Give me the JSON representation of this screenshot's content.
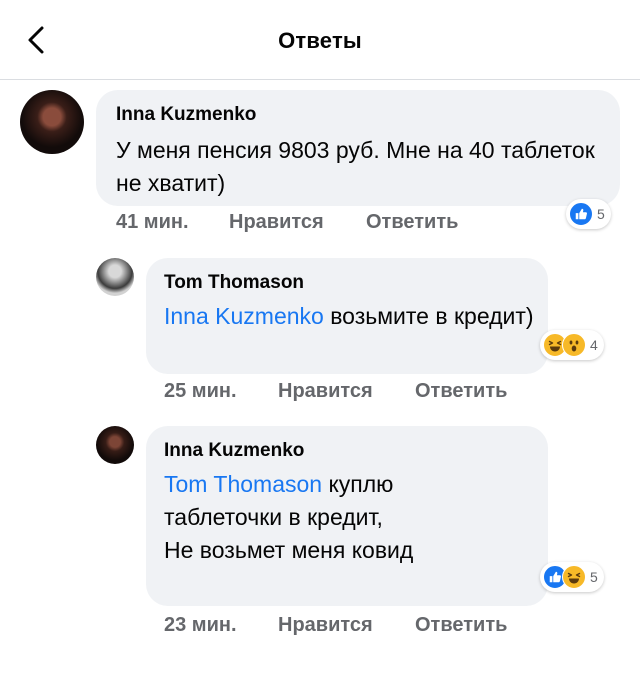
{
  "header": {
    "title": "Ответы"
  },
  "comments": [
    {
      "author": "Inna Kuzmenko",
      "mention": "",
      "text": "У меня пенсия 9803 руб. Мне на 40 таблеток не хватит)",
      "time": "41 мин.",
      "like_label": "Нравится",
      "reply_label": "Ответить",
      "reactions": [
        "like"
      ],
      "reaction_count": "5"
    },
    {
      "author": "Tom Thomason",
      "mention": "Inna Kuzmenko",
      "text": " возьмите в кредит)",
      "time": "25 мин.",
      "like_label": "Нравится",
      "reply_label": "Ответить",
      "reactions": [
        "haha",
        "wow"
      ],
      "reaction_count": "4"
    },
    {
      "author": "Inna Kuzmenko",
      "mention": "Tom Thomason",
      "text_line1": " куплю",
      "text_line2": "таблеточки в кредит,",
      "text_line3": "Не возьмет меня ковид",
      "time": "23 мин.",
      "like_label": "Нравится",
      "reply_label": "Ответить",
      "reactions": [
        "like",
        "haha"
      ],
      "reaction_count": "5"
    }
  ],
  "colors": {
    "link": "#1877f2",
    "bubble": "#f0f2f5",
    "meta": "#65676b"
  }
}
